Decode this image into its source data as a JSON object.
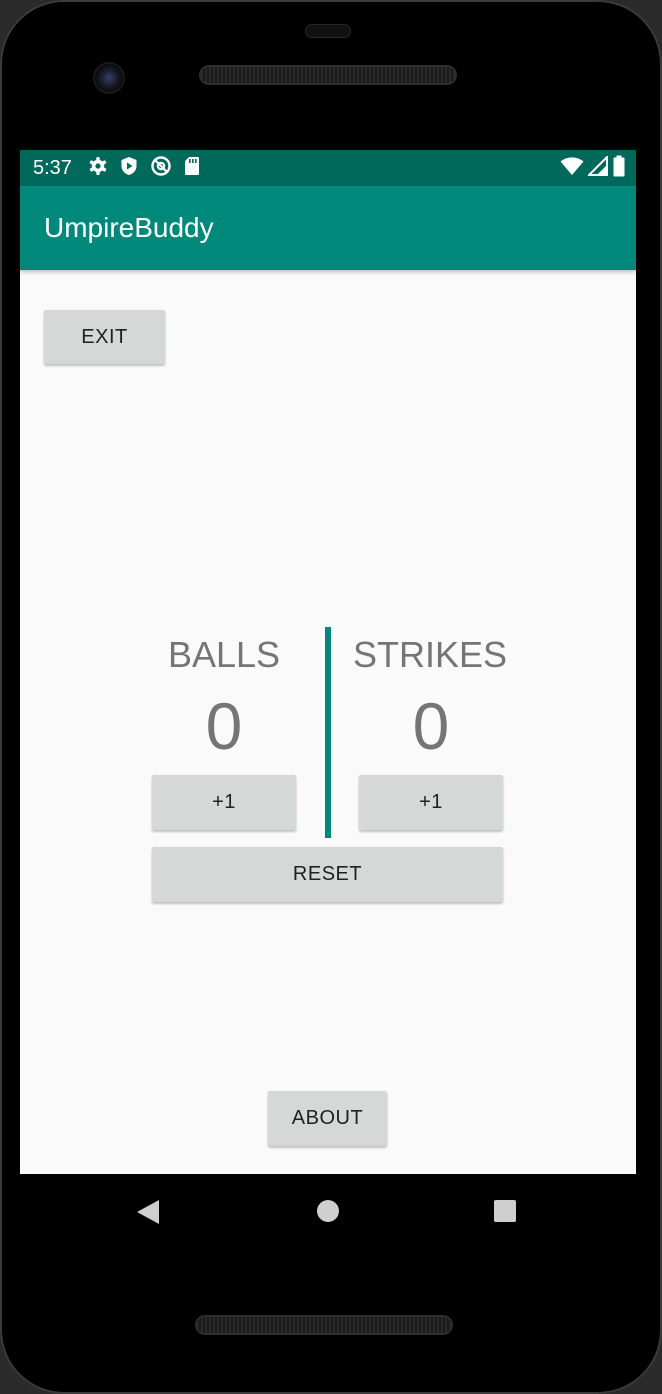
{
  "status_bar": {
    "time": "5:37",
    "left_icons": [
      "settings-icon",
      "play-protect-icon",
      "do-not-disturb-icon",
      "sd-card-icon"
    ],
    "right_icons": [
      "wifi-icon",
      "cell-signal-icon",
      "battery-icon"
    ]
  },
  "app_bar": {
    "title": "UmpireBuddy"
  },
  "main": {
    "exit_label": "EXIT",
    "balls": {
      "label": "BALLS",
      "count": "0",
      "increment_label": "+1"
    },
    "strikes": {
      "label": "STRIKES",
      "count": "0",
      "increment_label": "+1"
    },
    "reset_label": "RESET",
    "about_label": "ABOUT"
  },
  "nav_bar": {
    "buttons": [
      "back-icon",
      "home-icon",
      "recents-icon"
    ]
  },
  "colors": {
    "status_bar": "#00695c",
    "app_bar": "#00897b",
    "accent": "#00897b",
    "button": "#d6d7d7",
    "counter_text": "#757575"
  }
}
